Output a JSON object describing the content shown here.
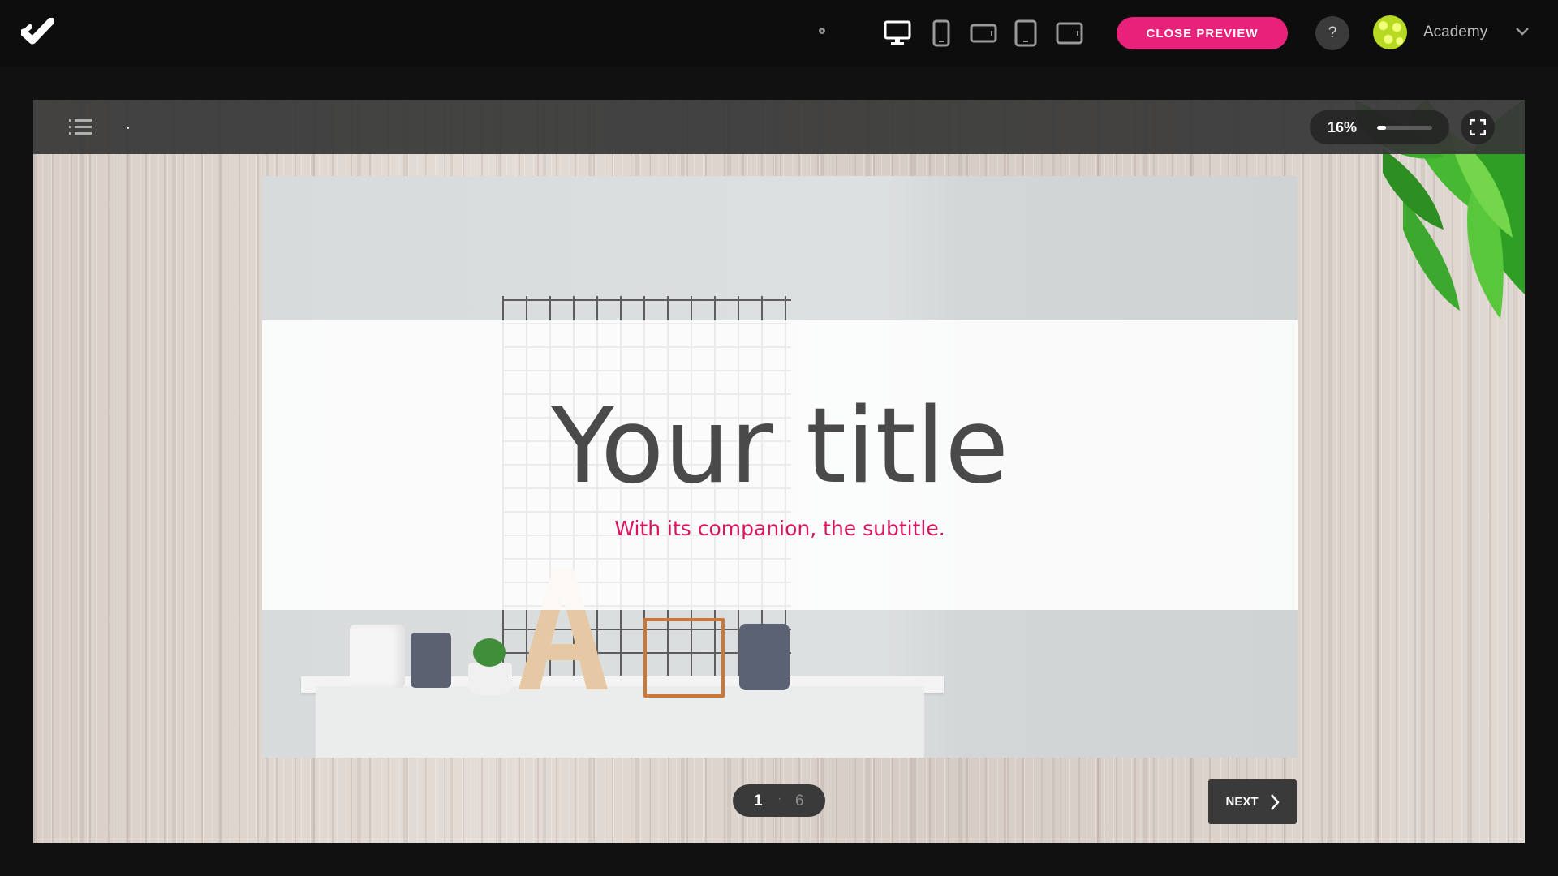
{
  "header": {
    "close_preview_label": "CLOSE PREVIEW",
    "help_label": "?",
    "account_name": "Academy",
    "devices": [
      "desktop-icon",
      "phone-portrait-icon",
      "phone-landscape-icon",
      "tablet-portrait-icon",
      "tablet-landscape-icon"
    ],
    "accent_color": "#e8227a"
  },
  "player": {
    "progress_text": "16%",
    "progress_value": 0.16
  },
  "slide": {
    "title": "Your title",
    "subtitle": "With its companion, the subtitle.",
    "subtitle_color": "#d8165f"
  },
  "pager": {
    "current": "1",
    "separator": "·",
    "total": "6"
  },
  "next_label": "NEXT"
}
